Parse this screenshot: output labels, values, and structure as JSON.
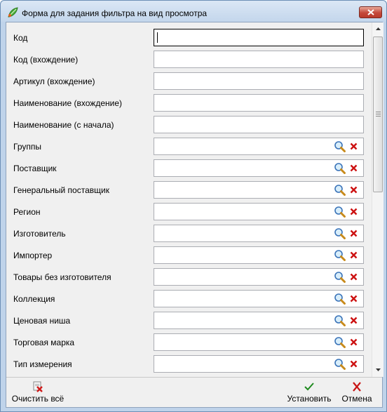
{
  "window": {
    "title": "Форма для задания фильтра на вид просмотра"
  },
  "fields": [
    {
      "label": "Код",
      "value": "",
      "lookup": false
    },
    {
      "label": "Код (вхождение)",
      "value": "",
      "lookup": false
    },
    {
      "label": "Артикул (вхождение)",
      "value": "",
      "lookup": false
    },
    {
      "label": "Наименование (вхождение)",
      "value": "",
      "lookup": false
    },
    {
      "label": "Наименование (с начала)",
      "value": "",
      "lookup": false
    },
    {
      "label": "Группы",
      "value": "",
      "lookup": true
    },
    {
      "label": "Поставщик",
      "value": "",
      "lookup": true
    },
    {
      "label": "Генеральный поставщик",
      "value": "",
      "lookup": true
    },
    {
      "label": "Регион",
      "value": "",
      "lookup": true
    },
    {
      "label": "Изготовитель",
      "value": "",
      "lookup": true
    },
    {
      "label": "Импортер",
      "value": "",
      "lookup": true
    },
    {
      "label": "Товары без изготовителя",
      "value": "",
      "lookup": true
    },
    {
      "label": "Коллекция",
      "value": "",
      "lookup": true
    },
    {
      "label": "Ценовая ниша",
      "value": "",
      "lookup": true
    },
    {
      "label": "Торговая марка",
      "value": "",
      "lookup": true
    },
    {
      "label": "Тип измерения",
      "value": "",
      "lookup": true
    }
  ],
  "toolbar": {
    "clear_all_label": "Очистить всё",
    "apply_label": "Установить",
    "cancel_label": "Отмена"
  },
  "icons": {
    "app": "app-leaf-icon",
    "close": "close-icon",
    "lookup": "magnifier-icon",
    "clear": "clear-x-icon",
    "clear_all": "clear-all-icon",
    "apply": "checkmark-icon",
    "cancel": "cancel-x-icon"
  },
  "colors": {
    "close_button": "#c4483a",
    "clear_x": "#cc1111",
    "checkmark": "#1f8a1f"
  }
}
